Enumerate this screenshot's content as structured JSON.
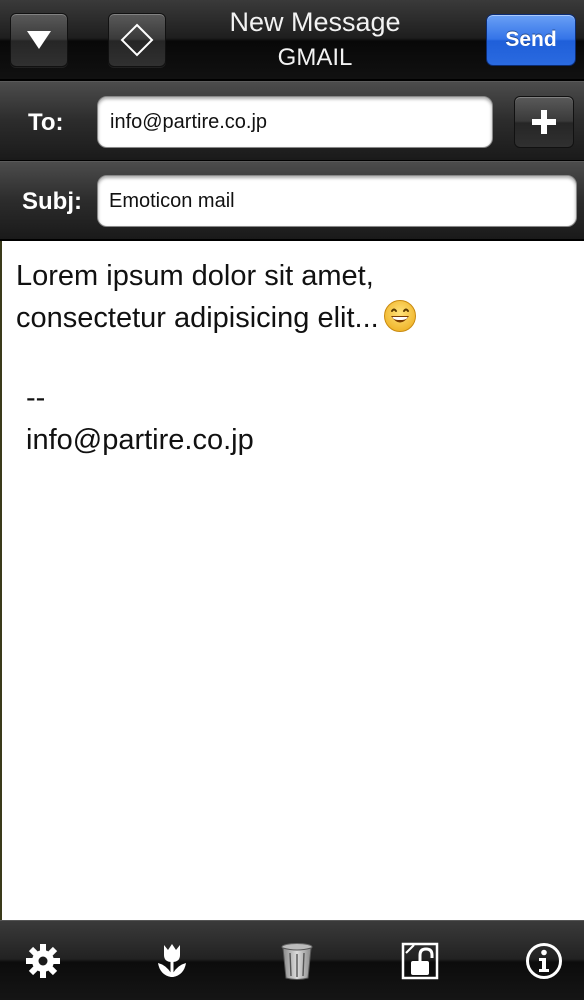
{
  "navbar": {
    "title": "New Message",
    "account": "GMAIL",
    "send_label": "Send",
    "left_icons": [
      "triangle-down-icon",
      "diamond-icon"
    ]
  },
  "to": {
    "label": "To:",
    "value": "info@partire.co.jp",
    "add_icon": "plus-icon"
  },
  "subject": {
    "label": "Subj:",
    "value": "Emoticon mail"
  },
  "message": {
    "line1": "Lorem ipsum dolor sit amet,",
    "line2": "consectetur adipisicing elit...",
    "emoji": "grinning-face-icon",
    "signature_sep": "--",
    "signature": "info@partire.co.jp"
  },
  "toolbar": {
    "icons": [
      "gear-icon",
      "tulip-icon",
      "trash-icon",
      "unlock-icon",
      "info-icon"
    ]
  },
  "colors": {
    "send_button": "#3474e8",
    "bar_dark": "#1e1e1e",
    "body_bg": "#ffffff"
  }
}
